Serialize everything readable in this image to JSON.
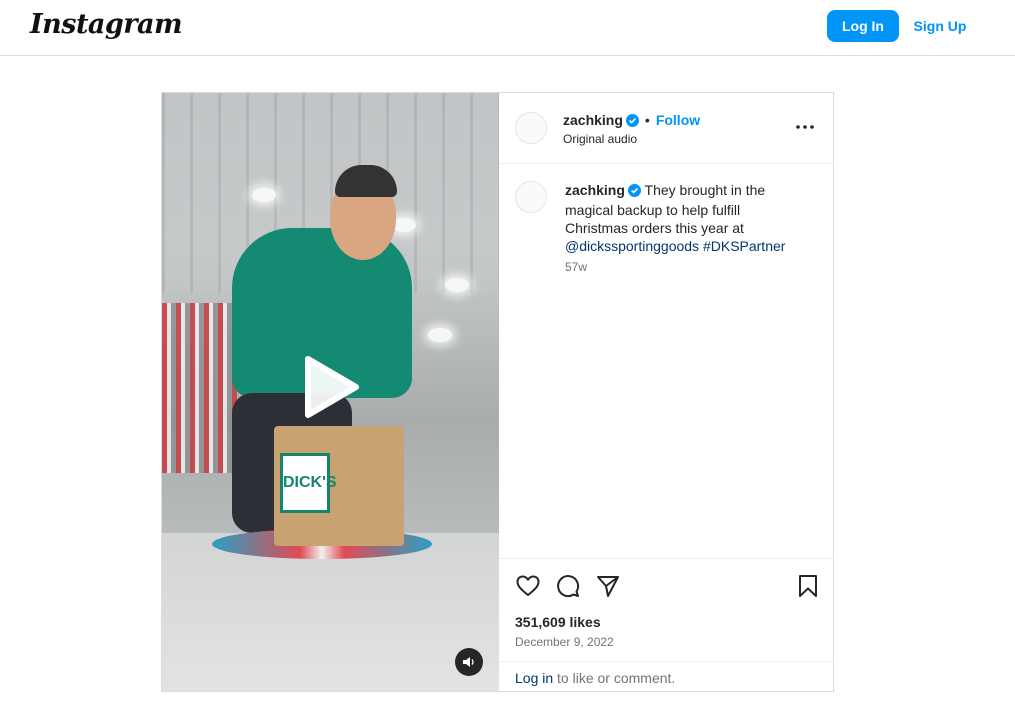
{
  "header": {
    "logo_text": "Instagram",
    "login_label": "Log In",
    "signup_label": "Sign Up"
  },
  "post": {
    "username": "zachking",
    "verified": true,
    "separator": "•",
    "follow_label": "Follow",
    "audio_label": "Original audio",
    "caption_username": "zachking",
    "caption_text": "They brought in the magical backup to help fulfill Christmas orders this year at",
    "caption_mention": "@dickssportinggoods",
    "caption_hashtag": "#DKSPartner",
    "time_ago": "57w",
    "likes": "351,609 likes",
    "date": "December 9, 2022",
    "login_link": "Log in",
    "login_suffix": " to like or comment.",
    "video_bag_text": "DICK'S"
  },
  "colors": {
    "accent": "#0095f6",
    "mention": "#00376b",
    "muted": "#737373",
    "border": "#dbdbdb"
  },
  "icons": {
    "play": "play-icon",
    "mute": "speaker-icon",
    "more": "more-options-icon",
    "like": "heart-icon",
    "comment": "comment-icon",
    "share": "share-icon",
    "save": "bookmark-icon",
    "verified": "verified-badge-icon"
  }
}
